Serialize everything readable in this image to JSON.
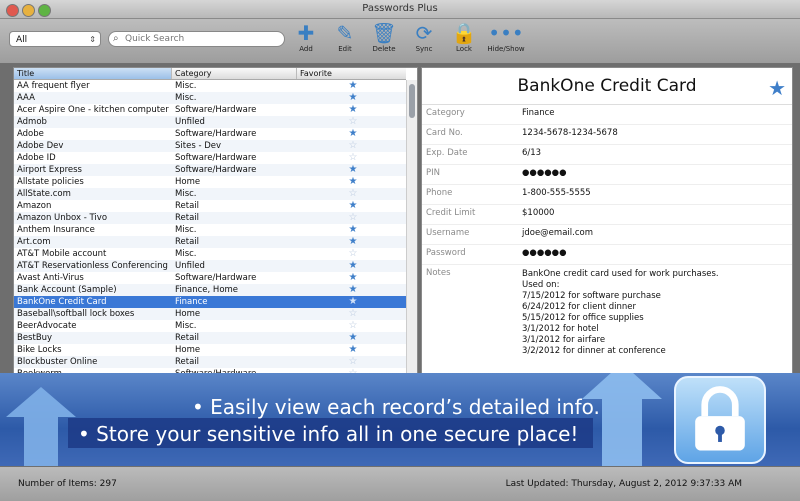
{
  "window": {
    "title": "Passwords Plus"
  },
  "toolbar": {
    "filter_value": "All",
    "search_placeholder": "Quick Search",
    "buttons": [
      {
        "label": "Add",
        "icon": "plus-icon"
      },
      {
        "label": "Edit",
        "icon": "pencil-icon"
      },
      {
        "label": "Delete",
        "icon": "trash-icon"
      },
      {
        "label": "Sync",
        "icon": "sync-icon"
      },
      {
        "label": "Lock",
        "icon": "lock-icon"
      },
      {
        "label": "Hide/Show",
        "icon": "dots-icon"
      }
    ]
  },
  "list": {
    "headers": [
      "Title",
      "Category",
      "Favorite"
    ],
    "rows": [
      {
        "title": "AA frequent flyer",
        "category": "Misc.",
        "fav": true
      },
      {
        "title": "AAA",
        "category": "Misc.",
        "fav": true
      },
      {
        "title": "Acer Aspire One - kitchen computer",
        "category": "Software/Hardware",
        "fav": true
      },
      {
        "title": "Admob",
        "category": "Unfiled",
        "fav": false
      },
      {
        "title": "Adobe",
        "category": "Software/Hardware",
        "fav": true
      },
      {
        "title": "Adobe Dev",
        "category": "Sites - Dev",
        "fav": false
      },
      {
        "title": "Adobe ID",
        "category": "Software/Hardware",
        "fav": false
      },
      {
        "title": "Airport Express",
        "category": "Software/Hardware",
        "fav": true
      },
      {
        "title": "Allstate policies",
        "category": "Home",
        "fav": true
      },
      {
        "title": "AllState.com",
        "category": "Misc.",
        "fav": false
      },
      {
        "title": "Amazon",
        "category": "Retail",
        "fav": true
      },
      {
        "title": "Amazon Unbox - Tivo",
        "category": "Retail",
        "fav": false
      },
      {
        "title": "Anthem Insurance",
        "category": "Misc.",
        "fav": true
      },
      {
        "title": "Art.com",
        "category": "Retail",
        "fav": true
      },
      {
        "title": "AT&T Mobile account",
        "category": "Misc.",
        "fav": false
      },
      {
        "title": "AT&T Reservationless Conferencing",
        "category": "Unfiled",
        "fav": true
      },
      {
        "title": "Avast Anti-Virus",
        "category": "Software/Hardware",
        "fav": true
      },
      {
        "title": "Bank Account (Sample)",
        "category": "Finance, Home",
        "fav": true
      },
      {
        "title": "BankOne Credit Card",
        "category": "Finance",
        "fav": true,
        "selected": true
      },
      {
        "title": "Baseball\\softball lock boxes",
        "category": "Home",
        "fav": false
      },
      {
        "title": "BeerAdvocate",
        "category": "Misc.",
        "fav": false
      },
      {
        "title": "BestBuy",
        "category": "Retail",
        "fav": true
      },
      {
        "title": "Bike Locks",
        "category": "Home",
        "fav": true
      },
      {
        "title": "Blockbuster Online",
        "category": "Retail",
        "fav": false
      },
      {
        "title": "Bookworm",
        "category": "Software/Hardware",
        "fav": false
      }
    ]
  },
  "detail": {
    "title": "BankOne Credit Card",
    "fields": [
      {
        "label": "Category",
        "value": "Finance"
      },
      {
        "label": "Card No.",
        "value": "1234-5678-1234-5678"
      },
      {
        "label": "Exp. Date",
        "value": "6/13"
      },
      {
        "label": "PIN",
        "value": "●●●●●●"
      },
      {
        "label": "Phone",
        "value": "1-800-555-5555"
      },
      {
        "label": "Credit Limit",
        "value": "$10000"
      },
      {
        "label": "Username",
        "value": "jdoe@email.com"
      },
      {
        "label": "Password",
        "value": "●●●●●●"
      }
    ],
    "notes_label": "Notes",
    "notes": [
      "BankOne credit card used for work purchases.",
      "Used on:",
      "7/15/2012 for software purchase",
      "6/24/2012 for client dinner",
      "5/15/2012 for office supplies",
      "3/1/2012 for hotel",
      "3/1/2012 for airfare",
      "3/2/2012 for dinner at conference"
    ]
  },
  "banner": {
    "line1": "• Easily view each record’s detailed info.",
    "line2": "• Store your sensitive info all in one secure place!"
  },
  "status": {
    "count": "Number of Items: 297",
    "updated": "Last Updated: Thursday, August 2, 2012 9:37:33 AM"
  },
  "colors": {
    "accent": "#3a78d6",
    "star": "#3f7fc9",
    "banner": "#2d5aa8"
  }
}
